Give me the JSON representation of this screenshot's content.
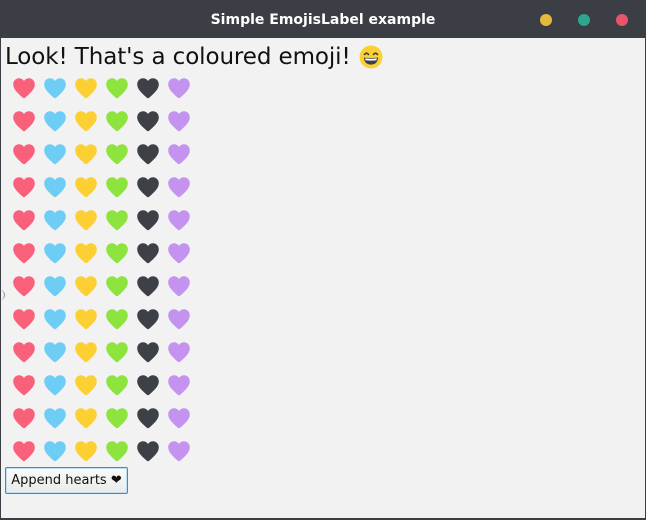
{
  "window": {
    "title": "Simple EmojisLabel example",
    "controls": [
      {
        "name": "minimize-button",
        "color": "#e8b83c"
      },
      {
        "name": "maximize-button",
        "color": "#2ea58e"
      },
      {
        "name": "close-button",
        "color": "#e8546a"
      }
    ]
  },
  "main": {
    "heading": "Look! That's a coloured emoji!",
    "heading_emoji": "grinning-face-icon",
    "hearts": {
      "rows": 12,
      "colors": [
        {
          "name": "red-heart-icon",
          "color": "#f9617a"
        },
        {
          "name": "blue-heart-icon",
          "color": "#6dcdf5"
        },
        {
          "name": "yellow-heart-icon",
          "color": "#fcd032"
        },
        {
          "name": "green-heart-icon",
          "color": "#8ee43f"
        },
        {
          "name": "black-heart-icon",
          "color": "#3d4147"
        },
        {
          "name": "purple-heart-icon",
          "color": "#c493ef"
        }
      ]
    },
    "append_button_label": "Append hearts ❤"
  }
}
